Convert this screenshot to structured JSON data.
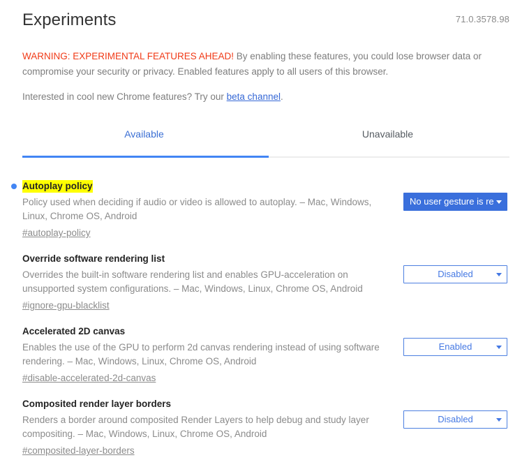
{
  "header": {
    "title": "Experiments",
    "version": "71.0.3578.98"
  },
  "blurb": {
    "warning": "WARNING: EXPERIMENTAL FEATURES AHEAD!",
    "warning_body": " By enabling these features, you could lose browser data or compromise your security or privacy. Enabled features apply to all users of this browser.",
    "beta_prefix": "Interested in cool new Chrome features? Try our ",
    "beta_link": "beta channel",
    "beta_suffix": "."
  },
  "tabs": [
    {
      "label": "Available",
      "active": true
    },
    {
      "label": "Unavailable",
      "active": false
    }
  ],
  "flags": [
    {
      "title": "Autoplay policy",
      "highlighted": true,
      "marker": true,
      "description": "Policy used when deciding if audio or video is allowed to autoplay. – Mac, Windows, Linux, Chrome OS, Android",
      "hash": "#autoplay-policy",
      "select": {
        "value": "No user gesture is required",
        "display": "No user gesture is re",
        "focused": true
      }
    },
    {
      "title": "Override software rendering list",
      "highlighted": false,
      "marker": false,
      "description": "Overrides the built-in software rendering list and enables GPU-acceleration on unsupported system configurations. – Mac, Windows, Linux, Chrome OS, Android",
      "hash": "#ignore-gpu-blacklist",
      "select": {
        "value": "Disabled",
        "display": "Disabled",
        "focused": false
      }
    },
    {
      "title": "Accelerated 2D canvas",
      "highlighted": false,
      "marker": false,
      "description": "Enables the use of the GPU to perform 2d canvas rendering instead of using software rendering. – Mac, Windows, Linux, Chrome OS, Android",
      "hash": "#disable-accelerated-2d-canvas",
      "select": {
        "value": "Enabled",
        "display": "Enabled",
        "focused": false
      }
    },
    {
      "title": "Composited render layer borders",
      "highlighted": false,
      "marker": false,
      "description": "Renders a border around composited Render Layers to help debug and study layer compositing. – Mac, Windows, Linux, Chrome OS, Android",
      "hash": "#composited-layer-borders",
      "select": {
        "value": "Disabled",
        "display": "Disabled",
        "focused": false
      }
    }
  ],
  "colors": {
    "accent_blue": "#4285f4",
    "warning_red": "#f03a17",
    "highlight_yellow": "#ffff00",
    "link_blue": "#3668d6",
    "muted_text": "#8b8b8b"
  },
  "icons": {
    "caret": "chevron-down-icon",
    "marker": "dot-marker-icon"
  }
}
